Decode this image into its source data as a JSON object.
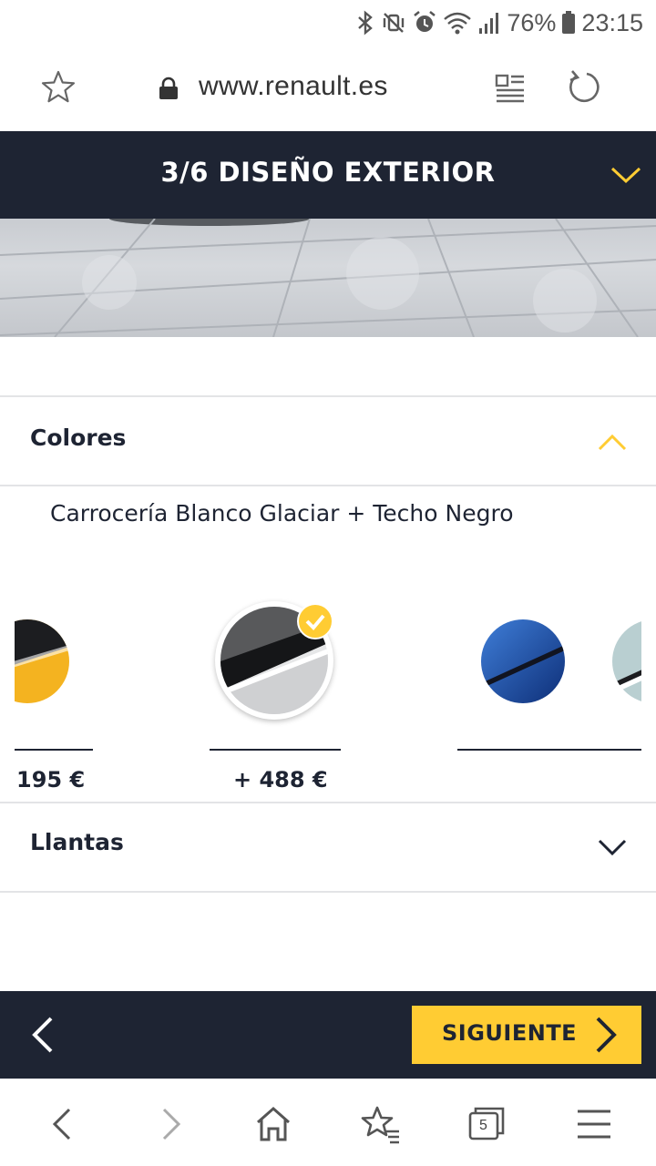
{
  "status_bar": {
    "battery": "76%",
    "time": "23:15"
  },
  "browser": {
    "url": "www.renault.es",
    "tab_count": "5"
  },
  "step": {
    "title": "3/6 DISEÑO EXTERIOR"
  },
  "colors_section": {
    "title": "Colores",
    "selected_name": "Carrocería Blanco Glaciar + Techo Negro",
    "swatches": [
      {
        "name": "yellow-black",
        "price": "195 €",
        "selected": false
      },
      {
        "name": "white-black",
        "price": "+ 488 €",
        "selected": true
      },
      {
        "name": "blue-black",
        "price": "",
        "selected": false
      },
      {
        "name": "light-blue",
        "price": "",
        "selected": false
      }
    ]
  },
  "wheels_section": {
    "title": "Llantas"
  },
  "footer": {
    "next_label": "SIGUIENTE"
  },
  "theme": {
    "navy": "#1e2433",
    "accent_yellow": "#ffcc33"
  },
  "icons": [
    "bluetooth-icon",
    "vibrate-mute-icon",
    "alarm-icon",
    "wifi-icon",
    "signal-icon",
    "battery-icon",
    "star-icon",
    "lock-icon",
    "reader-mode-icon",
    "reload-icon",
    "chevron-down-icon",
    "chevron-up-icon",
    "check-icon",
    "back-arrow-icon",
    "next-arrow-icon",
    "home-icon",
    "bookmarks-icon",
    "tabs-icon",
    "menu-icon"
  ]
}
